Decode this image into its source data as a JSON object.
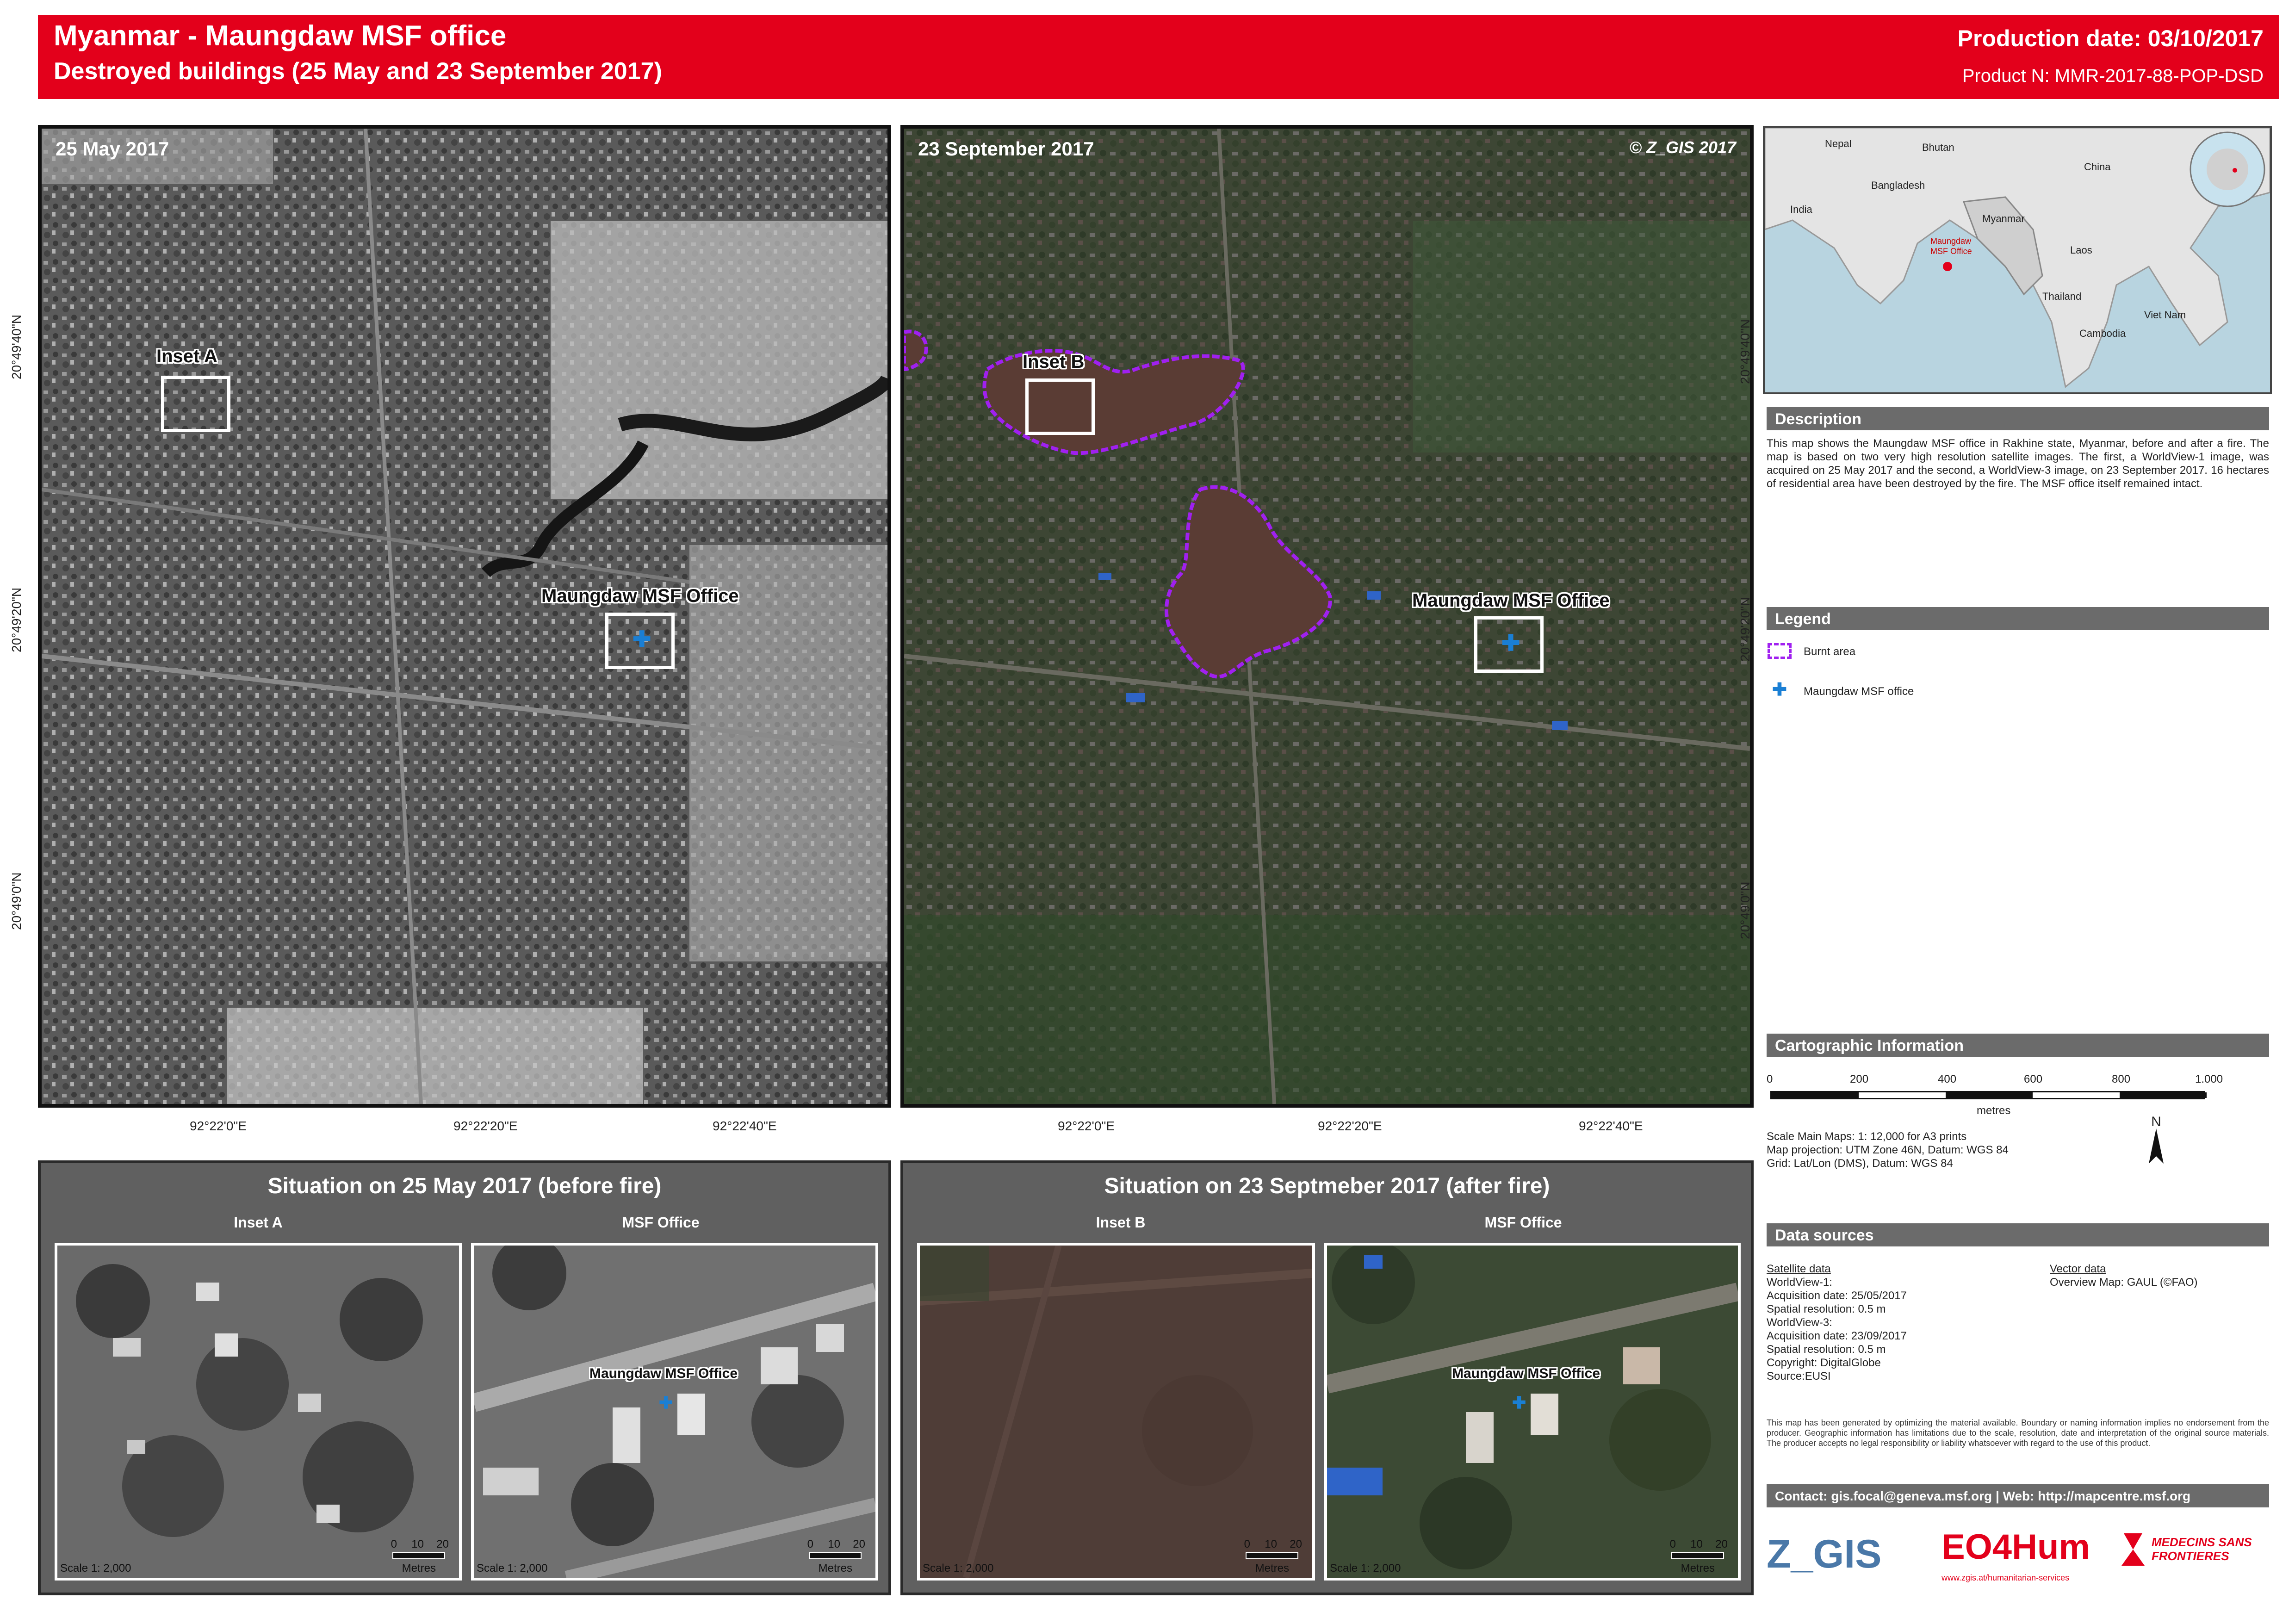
{
  "header": {
    "title": "Myanmar - Maungdaw MSF office",
    "subtitle": "Destroyed buildings (25 May and 23 September 2017)",
    "production_date": "Production date: 03/10/2017",
    "product_number": "Product N: MMR-2017-88-POP-DSD"
  },
  "map_left": {
    "date": "25 May 2017",
    "inset_label": "Inset A",
    "office_label": "Maungdaw MSF Office",
    "lon_ticks": [
      "92°22'0\"E",
      "92°22'20\"E",
      "92°22'40\"E"
    ],
    "lat_ticks": [
      "20°49'40\"N",
      "20°49'20\"N",
      "20°49'0\"N"
    ]
  },
  "map_right": {
    "date": "23 September 2017",
    "copyright": "© Z_GIS 2017",
    "inset_label": "Inset B",
    "office_label": "Maungdaw MSF Office",
    "lon_ticks": [
      "92°22'0\"E",
      "92°22'20\"E",
      "92°22'40\"E"
    ],
    "lat_ticks": [
      "20°49'40\"N",
      "20°49'20\"N",
      "20°49'0\"N"
    ]
  },
  "panel_left": {
    "title": "Situation on 25 May 2017 (before fire)",
    "inset1_title": "Inset A",
    "inset2_title": "MSF Office",
    "office_label": "Maungdaw MSF Office",
    "scale_text": "Scale 1: 2,000",
    "scale_ticks": [
      "0",
      "10",
      "20"
    ],
    "scale_unit": "Metres"
  },
  "panel_right": {
    "title": "Situation on 23 Septmeber 2017 (after fire)",
    "inset1_title": "Inset B",
    "inset2_title": "MSF Office",
    "office_label": "Maungdaw MSF Office",
    "scale_text": "Scale 1: 2,000",
    "scale_ticks": [
      "0",
      "10",
      "20"
    ],
    "scale_unit": "Metres"
  },
  "overview_map": {
    "labels": [
      "Nepal",
      "Bhutan",
      "Bangladesh",
      "India",
      "Myanmar",
      "China",
      "Laos",
      "Viet Nam",
      "Thailand",
      "Cambodia"
    ],
    "marker_label": "Maungdaw MSF Office"
  },
  "description": {
    "heading": "Description",
    "text": "This map shows the Maungdaw MSF office in Rakhine state, Myanmar, before and after a fire. The map is based on two very high resolution satellite images. The first, a WorldView-1 image, was acquired on 25 May 2017 and the second, a WorldView-3 image, on 23 September 2017. 16 hectares of residential area have been destroyed by the fire. The MSF office itself remained intact."
  },
  "legend": {
    "heading": "Legend",
    "items": [
      {
        "label": "Burnt area",
        "color": "#a020f0"
      },
      {
        "label": "Maungdaw MSF office",
        "color": "#1a7fd4"
      }
    ]
  },
  "cartographic": {
    "heading": "Cartographic Information",
    "scale_ticks": [
      "0",
      "200",
      "400",
      "600",
      "800",
      "1.000"
    ],
    "scale_unit": "metres",
    "lines": [
      "Scale Main Maps: 1: 12,000 for A3 prints",
      "Map projection: UTM Zone 46N, Datum: WGS 84",
      "Grid: Lat/Lon (DMS), Datum: WGS 84"
    ],
    "north": "N"
  },
  "data_sources": {
    "heading": "Data sources",
    "satellite_heading": "Satellite data",
    "satellite_lines": [
      "WorldView-1:",
      "Acquisition date: 25/05/2017",
      "Spatial resolution: 0.5 m",
      "WorldView-3:",
      "Acquisition date: 23/09/2017",
      "Spatial resolution: 0.5 m",
      "Copyright: DigitalGlobe",
      "Source:EUSI"
    ],
    "vector_heading": "Vector data",
    "vector_lines": [
      "Overview Map: GAUL (©FAO)"
    ],
    "disclaimer": "This map has been generated by optimizing the material available. Boundary or naming information implies no endorsement from the producer. Geographic information has limitations due to the scale, resolution, date and interpretation of the original source materials. The producer accepts no legal responsibility or liability whatsoever with regard to the use of this product."
  },
  "contact": "Contact: gis.focal@geneva.msf.org | Web: http://mapcentre.msf.org",
  "logos": {
    "zgis": "Z_GIS",
    "eo4hum": "EO4Hum",
    "eo4hum_url": "www.zgis.at/humanitarian-services",
    "msf": "MEDECINS SANS FRONTIERES"
  },
  "colors": {
    "header_red": "#e3001b",
    "burnt_area": "#a020f0",
    "msf_blue": "#1a7fd4",
    "section_gray": "#6b6b6b"
  }
}
